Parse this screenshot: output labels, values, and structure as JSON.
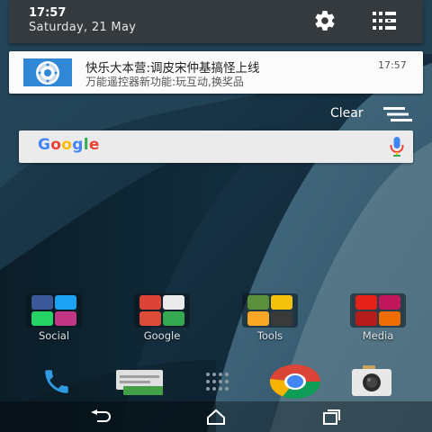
{
  "status": {
    "time": "17:57",
    "date": "Saturday, 21 May"
  },
  "icons": {
    "settings": "gear-icon",
    "quick_settings": "quick-settings-icon",
    "clear": "clear-all-icon",
    "mic": "mic-icon"
  },
  "notification": {
    "title": "快乐大本营:调皮宋仲基搞怪上线",
    "text": "万能遥控器新功能:玩互动,换奖品",
    "time": "17:57",
    "icon": "remote-control-icon"
  },
  "clear_label": "Clear",
  "search": {
    "logo": [
      "G",
      "o",
      "o",
      "g",
      "l",
      "e"
    ],
    "logo_colors": [
      "#4285f4",
      "#ea4335",
      "#fbbc05",
      "#4285f4",
      "#34a853",
      "#ea4335"
    ]
  },
  "folders": [
    {
      "label": "Social"
    },
    {
      "label": "Google"
    },
    {
      "label": "Tools"
    },
    {
      "label": "Media"
    }
  ],
  "dock": [
    "phone-icon",
    "messages-icon",
    "app-drawer-icon",
    "chrome-icon",
    "camera-icon"
  ],
  "nav": [
    "back-icon",
    "home-icon",
    "recents-icon"
  ]
}
